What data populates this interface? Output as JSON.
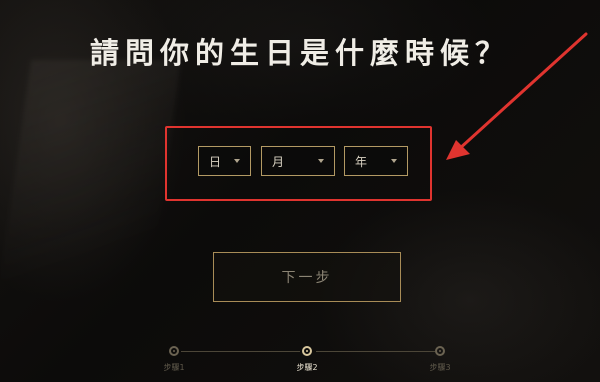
{
  "title": "請問你的生日是什麼時候？",
  "birthday_selects": {
    "day": {
      "label": "日"
    },
    "month": {
      "label": "月"
    },
    "year": {
      "label": "年"
    }
  },
  "next_button": {
    "label": "下一步"
  },
  "steps": [
    {
      "label": "步驟1",
      "active": false
    },
    {
      "label": "步驟2",
      "active": true
    },
    {
      "label": "步驟3",
      "active": false
    }
  ],
  "colors": {
    "highlight": "#e0342f",
    "gold_border": "#b39a64",
    "title_text": "#f0ede6"
  }
}
